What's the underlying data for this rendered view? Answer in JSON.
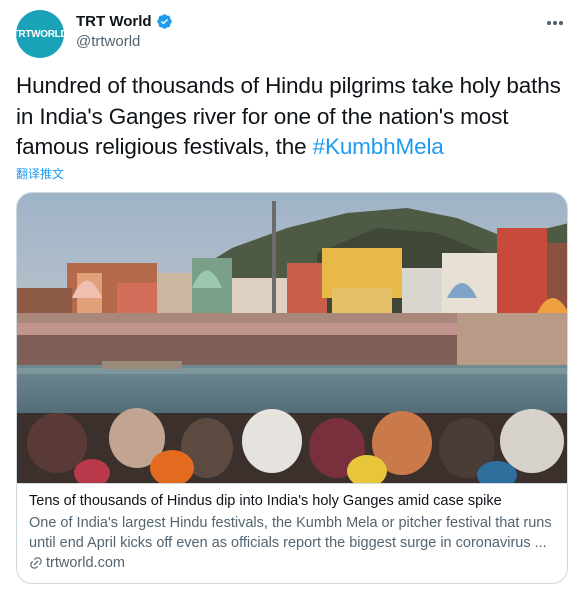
{
  "author": {
    "avatar_text": "TRTWORLD",
    "display_name": "TRT World",
    "handle": "@trtworld",
    "verified": true
  },
  "tweet": {
    "text_before_hashtag": "Hundred of thousands of Hindu pilgrims take holy baths in India's Ganges river for one of the nation's most famous religious festivals, the ",
    "hashtag": "#KumbhMela",
    "translate_label": "翻译推文"
  },
  "card": {
    "image_icon": "photo-ghat-crowd",
    "title": "Tens of thousands of Hindus dip into India's holy Ganges amid case spike",
    "description": "One of India's largest Hindu festivals, the Kumbh Mela or pitcher festival that runs until end April kicks off even as officials report the biggest surge in coronavirus ...",
    "domain": "trtworld.com"
  },
  "icons": {
    "more": "more-horizontal-icon",
    "verified": "verified-badge-icon",
    "link": "link-icon"
  },
  "colors": {
    "accent": "#1d9bf0",
    "avatar_bg": "#1aa3b8",
    "secondary_text": "#536471",
    "border": "#cfd9de"
  }
}
